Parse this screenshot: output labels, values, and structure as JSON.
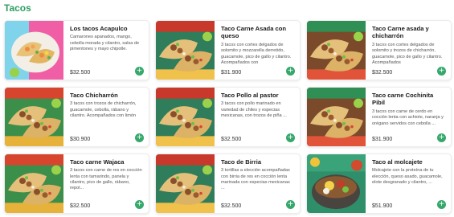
{
  "section": {
    "title": "Tacos"
  },
  "colors": {
    "accent": "#2e9d63",
    "button": "#36a86b"
  },
  "products": [
    {
      "name": "Los tacos Acapulco",
      "description": "Camarones apanados, mango, cebolla morada y cilantro, salsa de pimentones y mayo chipotle.",
      "price": "$32.500",
      "image": "pink-taco-plate"
    },
    {
      "name": "Taco Carne Asada con queso",
      "description": "3 tacos con cortes delgados de solomito y mozzarella derretido, guacamole, pico de gallo y cilantro. Acompañados con",
      "price": "$31.900",
      "image": "taco-plate"
    },
    {
      "name": "Taco Carne asada y chicharrón",
      "description": "3 tacos con cortes delgados de solomito y trozos de chicharrón, guacamole, pico de gallo y cilantro. Acompañados",
      "price": "$32.500",
      "image": "taco-plate"
    },
    {
      "name": "Taco Chicharrón",
      "description": "3 tacos con trozos de chicharrón, guacamole, cebolla, rábano y cilantro. Acompañados con limón",
      "price": "$30.900",
      "image": "taco-plate"
    },
    {
      "name": "Taco Pollo al pastor",
      "description": "3 tacos con pollo marinado en variedad de chiles y especias mexicanas, con trozos de piña ...",
      "price": "$32.500",
      "image": "taco-plate"
    },
    {
      "name": "Taco carne Cochinita Pibil",
      "description": "3 tacos con carne de cerdo en cocción lenta con achiote, naranja y orégano servidos con cebolla ...",
      "price": "$31.900",
      "image": "taco-plate"
    },
    {
      "name": "Taco carne Wajaca",
      "description": "3 tacos con carne de res en cocción lenta con tamarindo, panela y cilantro, pico de gallo, rábano, repol...",
      "price": "$32.500",
      "image": "taco-plate"
    },
    {
      "name": "Taco de Birria",
      "description": "3 tortillas a elección acompañadas con birria de res en cocción lenta marinada con especias mexicanas ...",
      "price": "$32.500",
      "image": "taco-plate"
    },
    {
      "name": "Taco al molcajete",
      "description": "Molcajete con la proteína de tu elección, queso asado, guacamole, elote desgranado y cilantro, ...",
      "price": "$51.900",
      "image": "molcajete-bowl"
    }
  ]
}
